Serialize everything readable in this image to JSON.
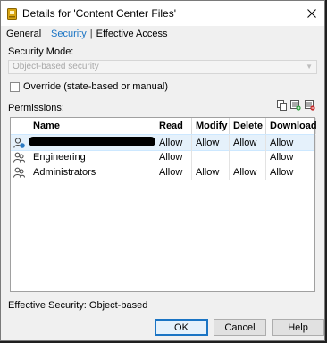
{
  "window": {
    "title": "Details for 'Content Center Files'"
  },
  "tabs": [
    {
      "label": "General"
    },
    {
      "label": "Security"
    },
    {
      "label": "Effective Access"
    }
  ],
  "security_mode": {
    "label": "Security Mode:",
    "value": "Object-based security"
  },
  "override": {
    "label": "Override (state-based or manual)",
    "checked": false
  },
  "permissions": {
    "label": "Permissions:",
    "columns": [
      "Name",
      "Read",
      "Modify",
      "Delete",
      "Download"
    ],
    "rows": [
      {
        "name": "",
        "read": "Allow",
        "modify": "Allow",
        "delete": "Allow",
        "download": "Allow",
        "selected": true,
        "icon": "user-icon"
      },
      {
        "name": "Engineering",
        "read": "Allow",
        "modify": "",
        "delete": "",
        "download": "Allow",
        "selected": false,
        "icon": "group-icon"
      },
      {
        "name": "Administrators",
        "read": "Allow",
        "modify": "Allow",
        "delete": "Allow",
        "download": "Allow",
        "selected": false,
        "icon": "group-icon"
      }
    ]
  },
  "effective_security": "Effective Security: Object-based",
  "buttons": {
    "ok": "OK",
    "cancel": "Cancel",
    "help": "Help"
  },
  "colors": {
    "accent": "#1a74c4",
    "selection": "#e5f1fb",
    "background": "#f0f0f0"
  }
}
